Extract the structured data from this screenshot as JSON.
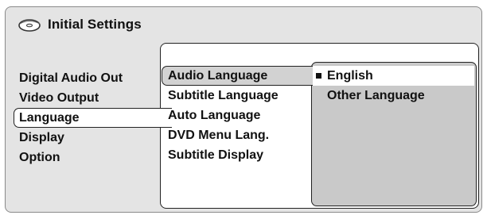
{
  "header": {
    "title": "Initial Settings",
    "icon": "disc-icon"
  },
  "left_menu": {
    "items": [
      {
        "label": "Digital Audio Out",
        "selected": false
      },
      {
        "label": "Video Output",
        "selected": false
      },
      {
        "label": "Language",
        "selected": true
      },
      {
        "label": "Display",
        "selected": false
      },
      {
        "label": "Option",
        "selected": false
      }
    ]
  },
  "middle_menu": {
    "items": [
      {
        "label": "Audio Language",
        "selected": true
      },
      {
        "label": "Subtitle Language",
        "selected": false
      },
      {
        "label": "Auto Language",
        "selected": false
      },
      {
        "label": "DVD Menu Lang.",
        "selected": false
      },
      {
        "label": "Subtitle Display",
        "selected": false
      }
    ]
  },
  "right_menu": {
    "items": [
      {
        "label": "English",
        "selected": true,
        "marker": "square-bullet-icon"
      },
      {
        "label": "Other Language",
        "selected": false
      }
    ]
  },
  "colors": {
    "frame_bg": "#e4e4e4",
    "panel_bg": "#ffffff",
    "right_panel_bg": "#c9c9c9",
    "highlight_mid": "#d2d2d2",
    "text": "#111111",
    "border": "#222222"
  }
}
